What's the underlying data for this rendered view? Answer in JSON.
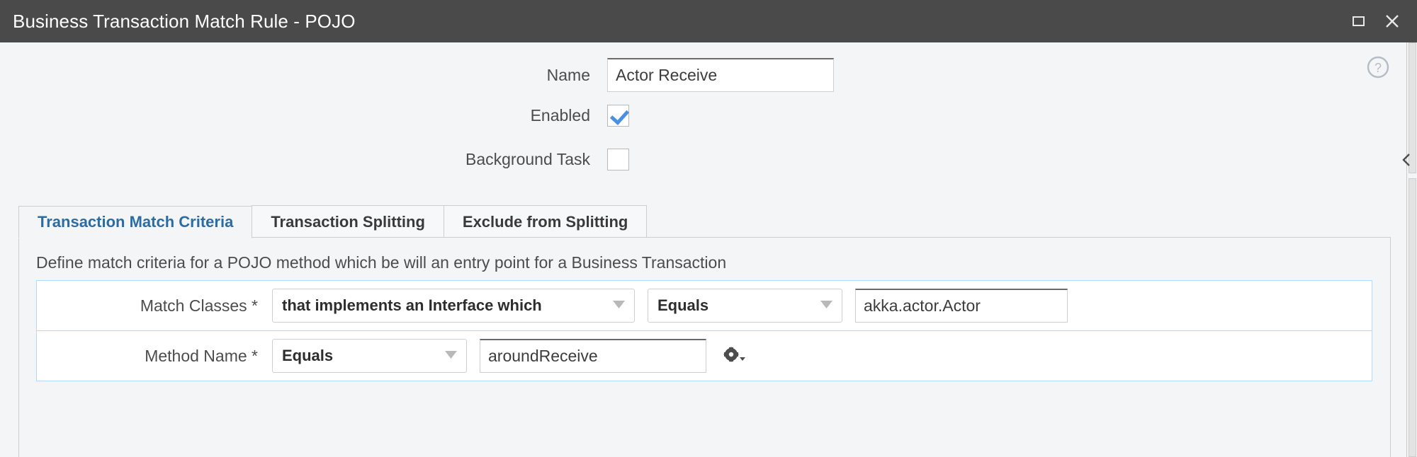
{
  "window": {
    "title": "Business Transaction Match Rule - POJO",
    "maximize_label": "Maximize",
    "close_label": "Close",
    "help_label": "Help",
    "collapse_label": "Collapse panel",
    "titlebar_color": "#4a4a4a",
    "background_color": "#f4f5f7"
  },
  "form": {
    "name": {
      "label": "Name",
      "value": "Actor Receive",
      "placeholder": ""
    },
    "enabled": {
      "label": "Enabled",
      "checked": true
    },
    "background_task": {
      "label": "Background Task",
      "checked": false
    }
  },
  "tabs": [
    {
      "label": "Transaction Match Criteria",
      "active": true
    },
    {
      "label": "Transaction Splitting",
      "active": false
    },
    {
      "label": "Exclude from Splitting",
      "active": false
    }
  ],
  "panel": {
    "description": "Define match criteria for a POJO method which be will an entry point for a Business Transaction",
    "criteria": [
      {
        "label": "Match Classes *",
        "match_type": "that implements an Interface which",
        "operator": "Equals",
        "value": "akka.actor.Actor",
        "has_gear": false
      },
      {
        "label": "Method Name *",
        "operator": "Equals",
        "value": "aroundReceive",
        "has_gear": true,
        "gear_label": "Method options"
      }
    ],
    "accent_color": "#b7d8f7",
    "active_tab_color": "#2b6ca3",
    "checkbox_color": "#4a90e2"
  }
}
